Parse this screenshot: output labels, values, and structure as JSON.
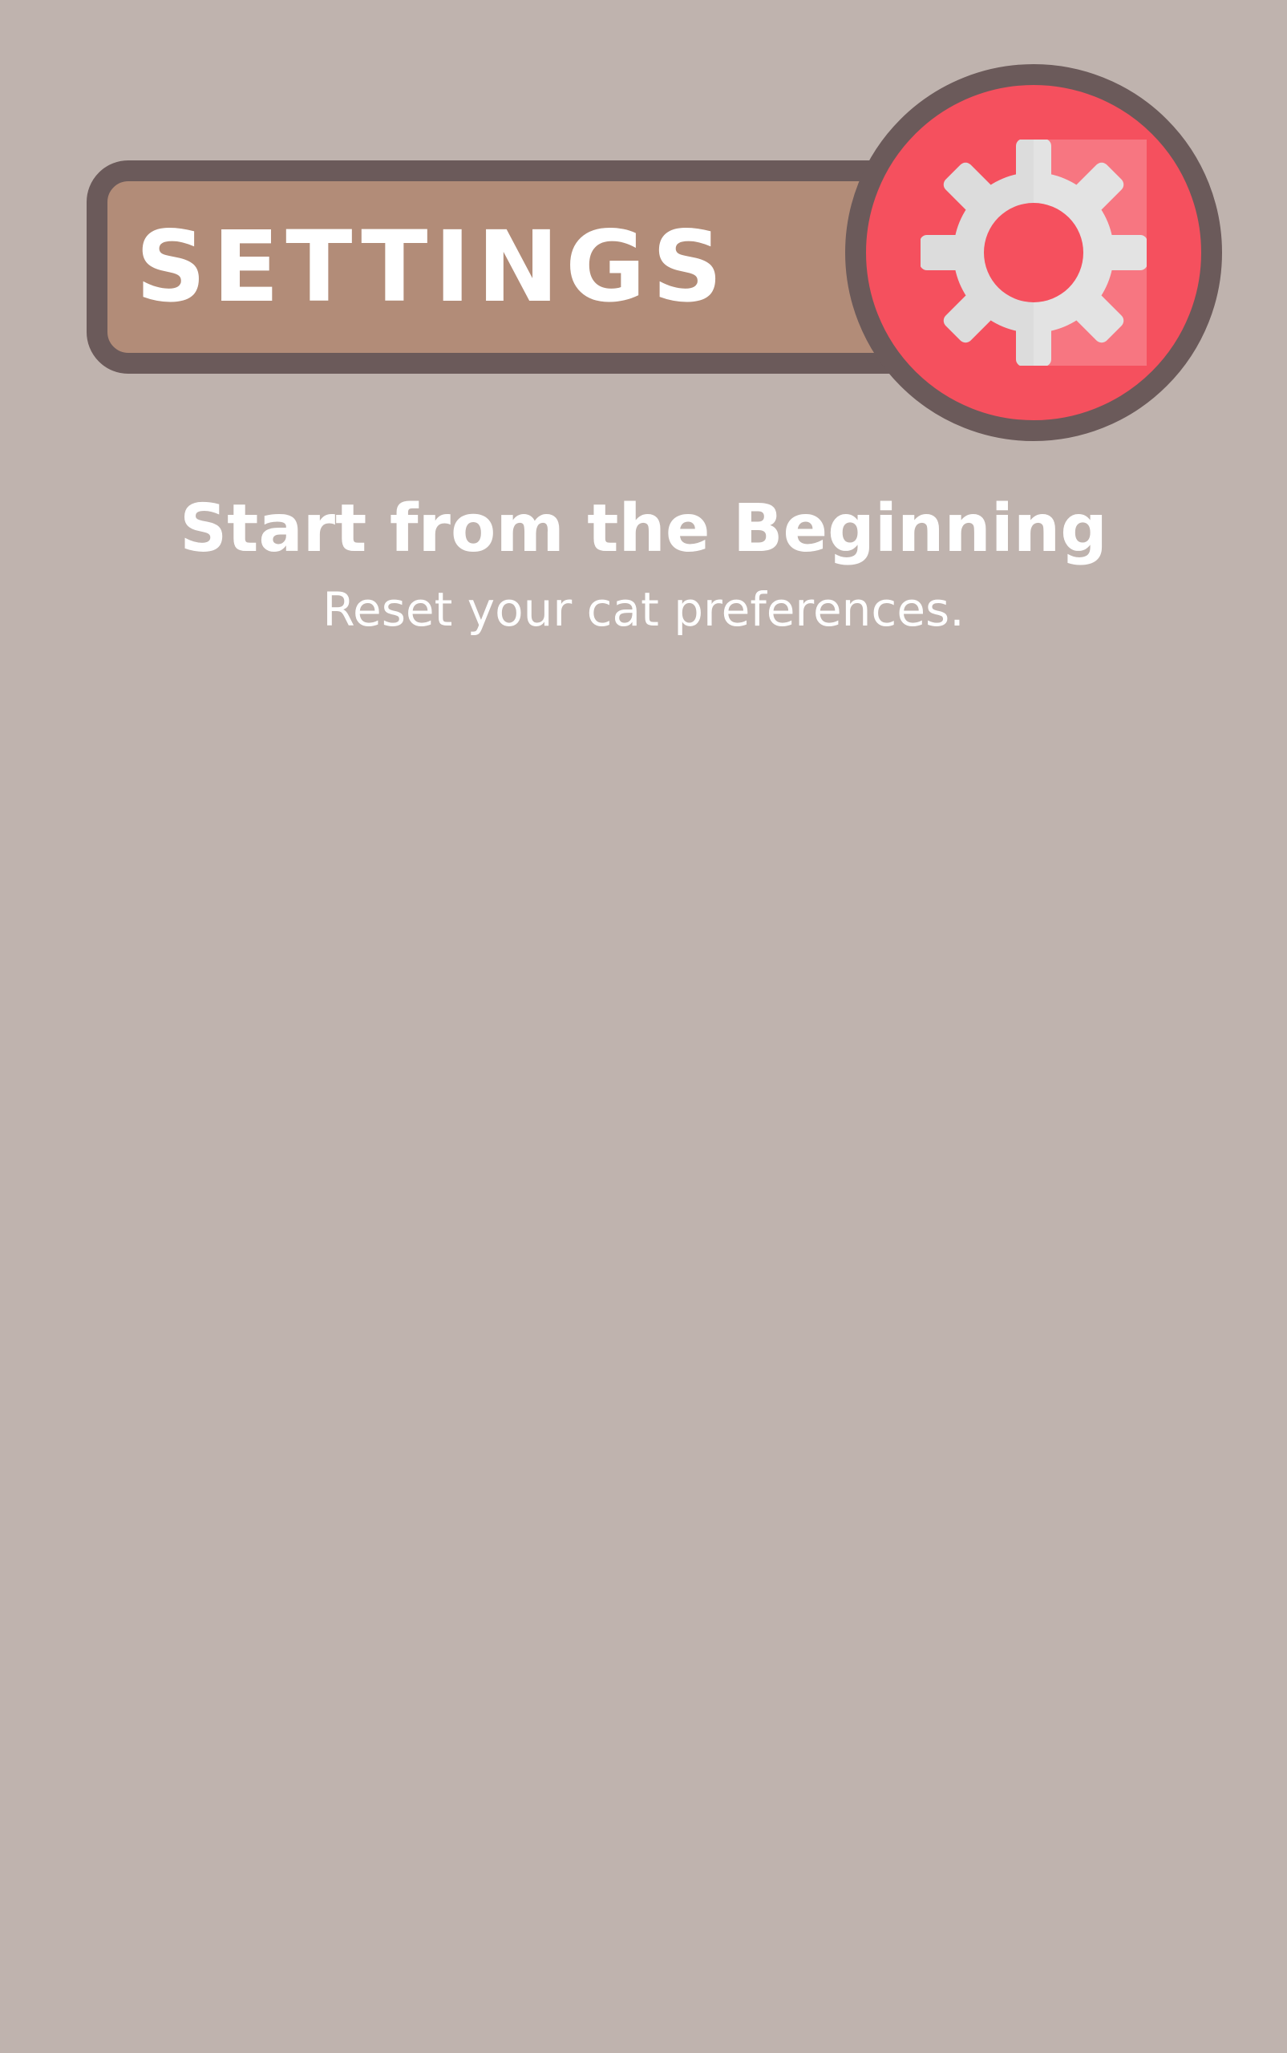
{
  "header": {
    "title": "SETTINGS",
    "settings_icon": "gear-icon"
  },
  "reset_option": {
    "title": "Start from the Beginning",
    "subtitle": "Reset your cat preferences."
  },
  "colors": {
    "background": "#bfb3ae",
    "banner_fill": "#b28c78",
    "border": "#6b5a5a",
    "accent": "#f5505e",
    "gear": "#e2e2e2",
    "text": "#ffffff"
  }
}
